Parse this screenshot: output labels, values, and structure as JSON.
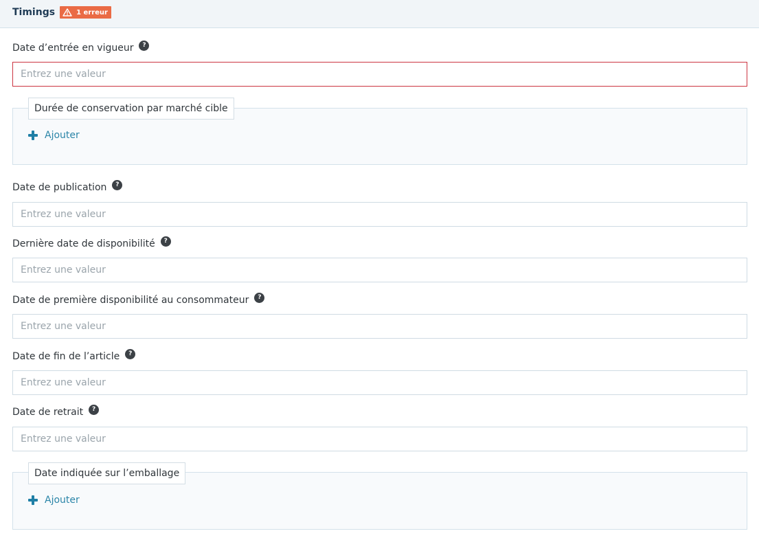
{
  "header": {
    "title": "Timings",
    "error_badge": "1 erreur",
    "warning_icon": "warning-triangle-icon"
  },
  "fields": {
    "effective_date": {
      "label": "Date d’entrée en vigueur",
      "placeholder": "Entrez une valeur",
      "value": "",
      "error": true
    },
    "retention_group": {
      "legend": "Durée de conservation par marché cible",
      "add_label": "Ajouter"
    },
    "publication_date": {
      "label": "Date de publication",
      "placeholder": "Entrez une valeur",
      "value": ""
    },
    "last_availability_date": {
      "label": "Dernière date de disponibilité",
      "placeholder": "Entrez une valeur",
      "value": ""
    },
    "first_consumer_availability_date": {
      "label": "Date de première disponibilité au consommateur",
      "placeholder": "Entrez une valeur",
      "value": ""
    },
    "item_end_date": {
      "label": "Date de fin de l’article",
      "placeholder": "Entrez une valeur",
      "value": ""
    },
    "withdrawal_date": {
      "label": "Date de retrait",
      "placeholder": "Entrez une valeur",
      "value": ""
    },
    "packaging_date_group": {
      "legend": "Date indiquée sur l’emballage",
      "add_label": "Ajouter"
    }
  },
  "help_glyph": "?",
  "colors": {
    "header_bg": "#f1f5f8",
    "title": "#1f3b55",
    "error_badge_bg": "#ea6b45",
    "error_border": "#cc3340",
    "input_border": "#cfdbe3",
    "link": "#2b85a8"
  }
}
